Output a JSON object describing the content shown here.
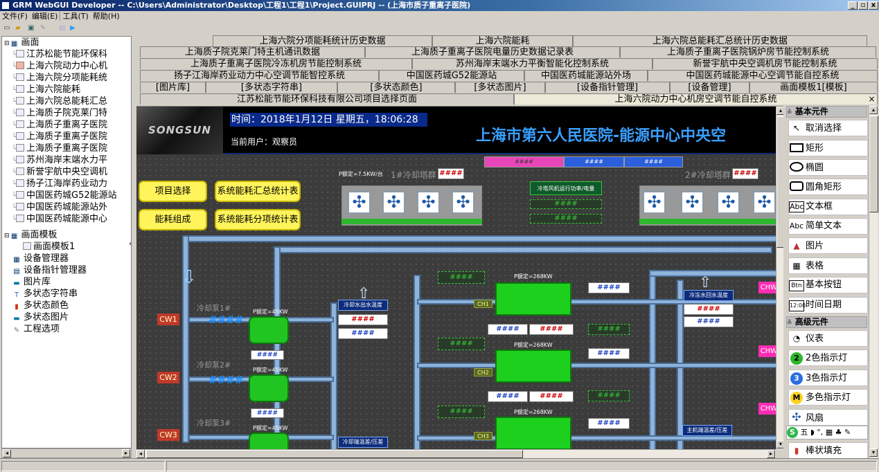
{
  "window": {
    "title": "GRM WebGUI Developer -- C:\\Users\\Administrator\\Desktop\\工程1\\工程1\\Project.GUIPRJ -- (上海市质子重离子医院)",
    "minimize": "_",
    "restore": "▫",
    "close": "x"
  },
  "menu": [
    "文件(F)",
    "编辑(E)",
    "工具(T)",
    "帮助(H)"
  ],
  "tree": {
    "root": "画面",
    "pages": [
      "江苏松能节能环保科",
      "上海六院动力中心机",
      "上海六院分项能耗统",
      "上海六院能耗",
      "上海六院总能耗汇总",
      "上海质子院克莱门特",
      "上海质子重离子医院",
      "上海质子重离子医院",
      "上海质子重离子医院",
      "苏州海岸末端水力平",
      "新誉宇航中央空调机",
      "扬子江海岸药业动力",
      "中国医药城G52能源站",
      "中国医药城能源站外",
      "中国医药城能源中心"
    ],
    "templates_root": "画面模板",
    "templates": [
      "画面模板1"
    ],
    "managers": [
      "设备管理器",
      "设备指针管理器",
      "图片库",
      "多状态字符串",
      "多状态颜色",
      "多状态图片",
      "工程选项"
    ]
  },
  "tabs": {
    "row1": [
      "上海六院分项能耗统计历史数据",
      "上海六院能耗",
      "上海六院总能耗汇总统计历史数据"
    ],
    "row2": [
      "上海质子院克莱门特主机通讯数据",
      "上海质子重离子医院电量历史数据记录表",
      "上海质子重离子医院锅炉房节能控制系统"
    ],
    "row3": [
      "上海质子重离子医院冷冻机房节能控制系统",
      "苏州海岸末端水力平衡智能化控制系统",
      "新誉宇航中央空调机房节能控制系统"
    ],
    "row4": [
      "扬子江海岸药业动力中心空调节能智控系统",
      "中国医药城G52能源站",
      "中国医药城能源站外场",
      "中国医药城能源中心空调节能自控系统"
    ],
    "row5": [
      "[图片库]",
      "[多状态字符串]",
      "[多状态颜色]",
      "[多状态图片]",
      "[设备指针管理]",
      "[设备管理]",
      "画面模板1[模板]"
    ],
    "row6": [
      "江苏松能节能环保科技有限公司项目选择页面",
      "上海六院动力中心机房空调节能自控系统"
    ],
    "close": "×"
  },
  "canvas": {
    "time": "时间：2018年1月12日 星期五，18:06:28",
    "user": "当前用户：观察员",
    "title": "上海市第六人民医院-能源中心中央空",
    "logo": "SONGSUN",
    "buttons": [
      "项目选择",
      "系统能耗汇总统计表",
      "能耗组成",
      "系统能耗分项统计表"
    ],
    "hash": "####",
    "tower1_label": "1#冷却塔群",
    "tower1_rated": "P额定=7.5KW/台",
    "tower2_label": "2#冷却塔群",
    "fan_panel_title": "冷塔风机运行功率/电量",
    "pump1": "冷却泵1#",
    "pump2": "冷却泵2#",
    "pump3": "冷却泵3#",
    "pump_rated": "P额定=45KW",
    "chiller_rated": "P额定=268KW",
    "cw": [
      "CW1",
      "CW2",
      "CW3"
    ],
    "ch": [
      "CH1",
      "CH2",
      "CH3"
    ],
    "chw": [
      "CHW",
      "CHW",
      "CHW"
    ],
    "cool_out_temp": "冷却水出水温度",
    "cool_diff": "冷却端温差/压差",
    "chw_return_temp": "冷冻水回水温度",
    "host_diff": "主机端温差/压差"
  },
  "palette": {
    "basic": "基本元件",
    "basic_items": [
      "取消选择",
      "矩形",
      "椭圆",
      "圆角矩形",
      "文本框",
      "简单文本",
      "图片",
      "表格",
      "基本按钮",
      "时间日期"
    ],
    "advanced": "高级元件",
    "advanced_items": [
      "仪表",
      "2色指示灯",
      "3色指示灯",
      "多色指示灯",
      "风扇",
      "棒状填充"
    ],
    "icons": {
      "rect_text": "Abc",
      "simple_text": "Abc",
      "button": "Btn",
      "datetime": "12:00",
      "lamp2": "2",
      "lamp3": "3",
      "lampm": "M"
    }
  },
  "colors": {
    "titlebar": "#0a246a",
    "canvas": "#3c3c3c",
    "accent_blue": "#0d2c7a",
    "pipe": "#8fb3d9",
    "green": "#21c521",
    "yellow": "#fff45c"
  }
}
